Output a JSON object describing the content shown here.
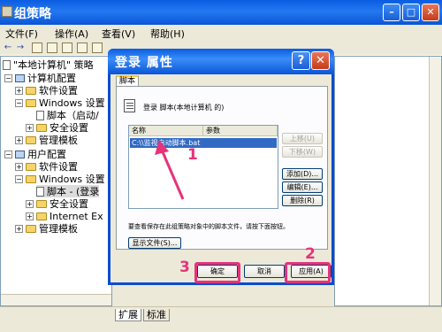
{
  "window": {
    "title": "组策略"
  },
  "menu": [
    "文件(F)",
    "操作(A)",
    "查看(V)",
    "帮助(H)"
  ],
  "tree": [
    {
      "label": "\"本地计算机\" 策略",
      "kind": "root"
    },
    {
      "label": "计算机配置",
      "kind": "pc"
    },
    {
      "label": "软件设置",
      "kind": "folder"
    },
    {
      "label": "Windows 设置",
      "kind": "folder"
    },
    {
      "label": "脚本（启动/",
      "kind": "doc"
    },
    {
      "label": "安全设置",
      "kind": "folder"
    },
    {
      "label": "管理模板",
      "kind": "folder"
    },
    {
      "label": "用户配置",
      "kind": "pc"
    },
    {
      "label": "软件设置",
      "kind": "folder"
    },
    {
      "label": "Windows 设置",
      "kind": "folder"
    },
    {
      "label": "脚本 - (登录",
      "kind": "doc"
    },
    {
      "label": "安全设置",
      "kind": "folder"
    },
    {
      "label": "Internet Ex",
      "kind": "folder"
    },
    {
      "label": "管理模板",
      "kind": "folder"
    }
  ],
  "status_tabs": [
    "扩展",
    "标准"
  ],
  "dialog": {
    "title": "登录 属性",
    "help_glyph": "?",
    "close_glyph": "✕",
    "tab": "脚本",
    "heading": "登录 脚本(本地计算机 的)",
    "col_name": "名称",
    "col_params": "参数",
    "selected_row": "C:\\\\监视启动脚本.bat",
    "side_buttons": [
      "上移(U)",
      "下移(W)",
      "添加(D)...",
      "编辑(E)...",
      "删除(R)"
    ],
    "note": "要查看保存在此组策略对象中的脚本文件，请按下面按钮。",
    "show_files": "显示文件(S)...",
    "ok": "确定",
    "cancel": "取消",
    "apply": "应用(A)"
  },
  "annotations": [
    "1",
    "2",
    "3"
  ],
  "colors": {
    "highlight": "#e6337a",
    "titlebar": "#0a5de0",
    "selection": "#316ac5"
  }
}
